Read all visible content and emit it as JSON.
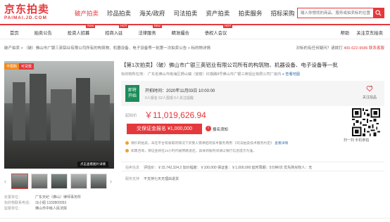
{
  "logo": {
    "main": "京东拍卖",
    "sub": "PAIMAI.JD.COM"
  },
  "mainnav": [
    "破产拍卖",
    "珍品拍卖",
    "海关/政府",
    "司法拍卖",
    "资产拍卖",
    "拍卖服务",
    "招标采购"
  ],
  "search": {
    "placeholder": "输入你想找的商品、服务或拍卖标的位置"
  },
  "subnav": {
    "items": [
      {
        "label": "首页",
        "tag": ""
      },
      {
        "label": "拍卖公告",
        "tag": ""
      },
      {
        "label": "投资人招募",
        "tag": "New"
      },
      {
        "label": "招商入驻",
        "tag": "HOT"
      },
      {
        "label": "法律服务",
        "tag": "New"
      },
      {
        "label": "精准撮合",
        "tag": ""
      },
      {
        "label": "债权人会议",
        "tag": "HOT"
      }
    ],
    "right": [
      "帮助",
      "关注京东拍卖"
    ]
  },
  "crumb": {
    "path": "破产拍卖 > （破）佛山市广银三英铝业有限公司所有的构筑物、机器设备、电子设备等一批第一次拍卖公告 > 标的物详情",
    "right_prefix": "对标的有任何疑问？请拨打",
    "phone": "400-622-9586",
    "contact": "联系客服"
  },
  "gallery": {
    "badge_live": "不限购",
    "badge_loan": "可贷款",
    "pano": "点击查看图片详情"
  },
  "lot": {
    "title": "【第1次拍卖】（破）佛山市广银三英铝业有限公司所有的构筑物、机器设备、电子设备等一批",
    "location_prefix": "标的物所在地：",
    "location": "广东省佛山市南海区狮山镇（官窑）红旗路8号佛山市广银三英铝业有限公司厂房内",
    "map_link": "查看地图"
  },
  "status": {
    "tag_line1": "即将",
    "tag_line2": "开始",
    "start_time": "开拍时间：2020年11月03日 10:00:00",
    "counts": "0人报名   62人围观   0人关注提醒",
    "follow": "关注拍品"
  },
  "price": {
    "label": "起拍价",
    "value": "￥11,019,626.94",
    "bid_button": "交保证金报名 ¥1,000,000",
    "flag": "!",
    "flag_label": "报名须知",
    "note1": "保价的拍卖，未在平台有收取的情况下买受人需承担的技术服务费用   《司法拍卖技术服务约定》",
    "note1_link": "查看详情",
    "note2": "如需咨询，保证金将在24小时内被原路退还，具体到账时间请以银行信息提示为准。"
  },
  "qr": {
    "label": "扫一扫 手机参拍"
  },
  "info": {
    "label": "拍卖信息",
    "text": "评估价：￥15,742,324.2   加价幅度：￥100,000   保证金：￥1,000,000   延时周期：5分钟/次   优先购买权人：无"
  },
  "service": {
    "label": "服务支持",
    "text": "不支持七天无理由退货"
  },
  "bottom": [
    {
      "k": "处置单位：",
      "v": "广东天纪（佛山）律师事务所"
    },
    {
      "k": "标的物联系电话：",
      "v": "冯小姐 1332809353"
    },
    {
      "k": "监督单位：",
      "v": "佛山市中级人民法院"
    }
  ],
  "colors": {
    "brand": "#e4393c",
    "status_green": "#1d8c5a"
  }
}
